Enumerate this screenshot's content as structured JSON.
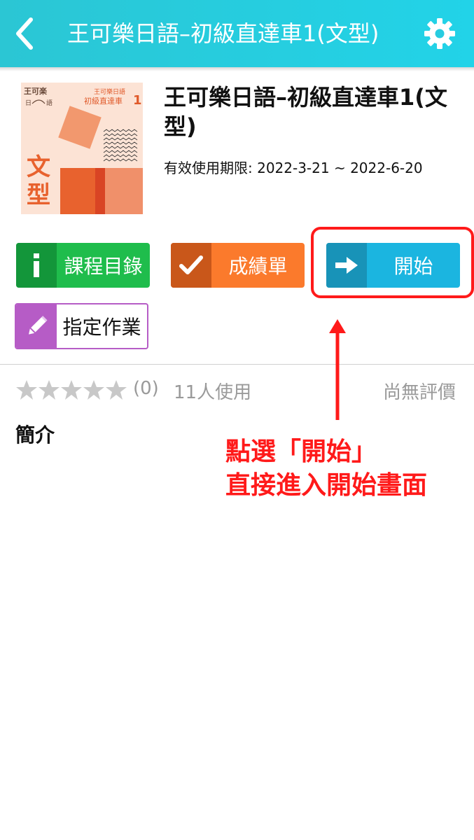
{
  "header": {
    "title": "王可樂日語–初級直達車1(文型)"
  },
  "cover": {
    "brand": "王可楽",
    "brand_sub_left": "日",
    "brand_sub_right": "語",
    "series": "王可樂日語",
    "subtitle": "初級直達車",
    "number": "1",
    "char1": "文",
    "char2": "型"
  },
  "course": {
    "title": "王可樂日語–初級直達車1(文型)",
    "validity": "有效使用期限: 2022-3-21 ~ 2022-6-20"
  },
  "buttons": {
    "catalog": "課程目錄",
    "report": "成績單",
    "start": "開始",
    "homework": "指定作業"
  },
  "rating": {
    "stars": 0,
    "count": "(0)",
    "users": "11人使用",
    "status": "尚無評價"
  },
  "intro_heading": "簡介",
  "annotation": {
    "line1": "點選「開始」",
    "line2": "直接進入開始畫面"
  },
  "colors": {
    "header": "#22d3e8",
    "catalog": "#1fbd4c",
    "report": "#fb7a2c",
    "start": "#1bb5e0",
    "homework": "#b65cc6",
    "annotation": "#ff1a1a"
  }
}
